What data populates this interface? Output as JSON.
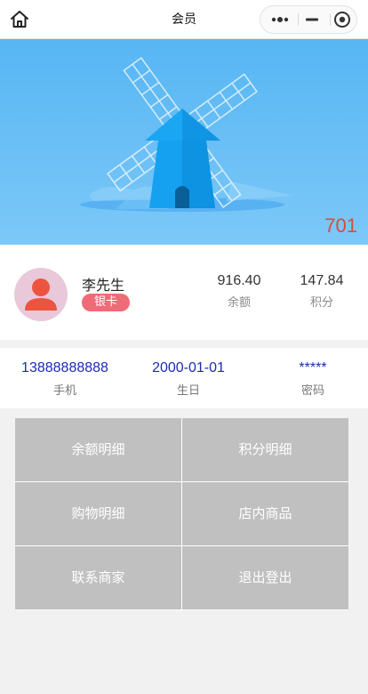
{
  "nav": {
    "title": "会员"
  },
  "banner": {
    "number": "701"
  },
  "member": {
    "name": "李先生",
    "level": "银卡",
    "balance": {
      "value": "916.40",
      "label": "余额"
    },
    "points": {
      "value": "147.84",
      "label": "积分"
    }
  },
  "info": {
    "phone": {
      "value": "13888888888",
      "label": "手机"
    },
    "birthday": {
      "value": "2000-01-01",
      "label": "生日"
    },
    "password": {
      "value": "*****",
      "label": "密码"
    }
  },
  "menu": [
    {
      "label": "余额明细"
    },
    {
      "label": "积分明细"
    },
    {
      "label": "购物明细"
    },
    {
      "label": "店内商品"
    },
    {
      "label": "联系商家"
    },
    {
      "label": "退出登出"
    }
  ],
  "colors": {
    "banner_sky": "#57b6f3",
    "accent_red": "#e0483a",
    "badge_pink": "#ef6b78",
    "info_blue": "#1a2db0",
    "menu_gray": "#c0c0c0"
  }
}
